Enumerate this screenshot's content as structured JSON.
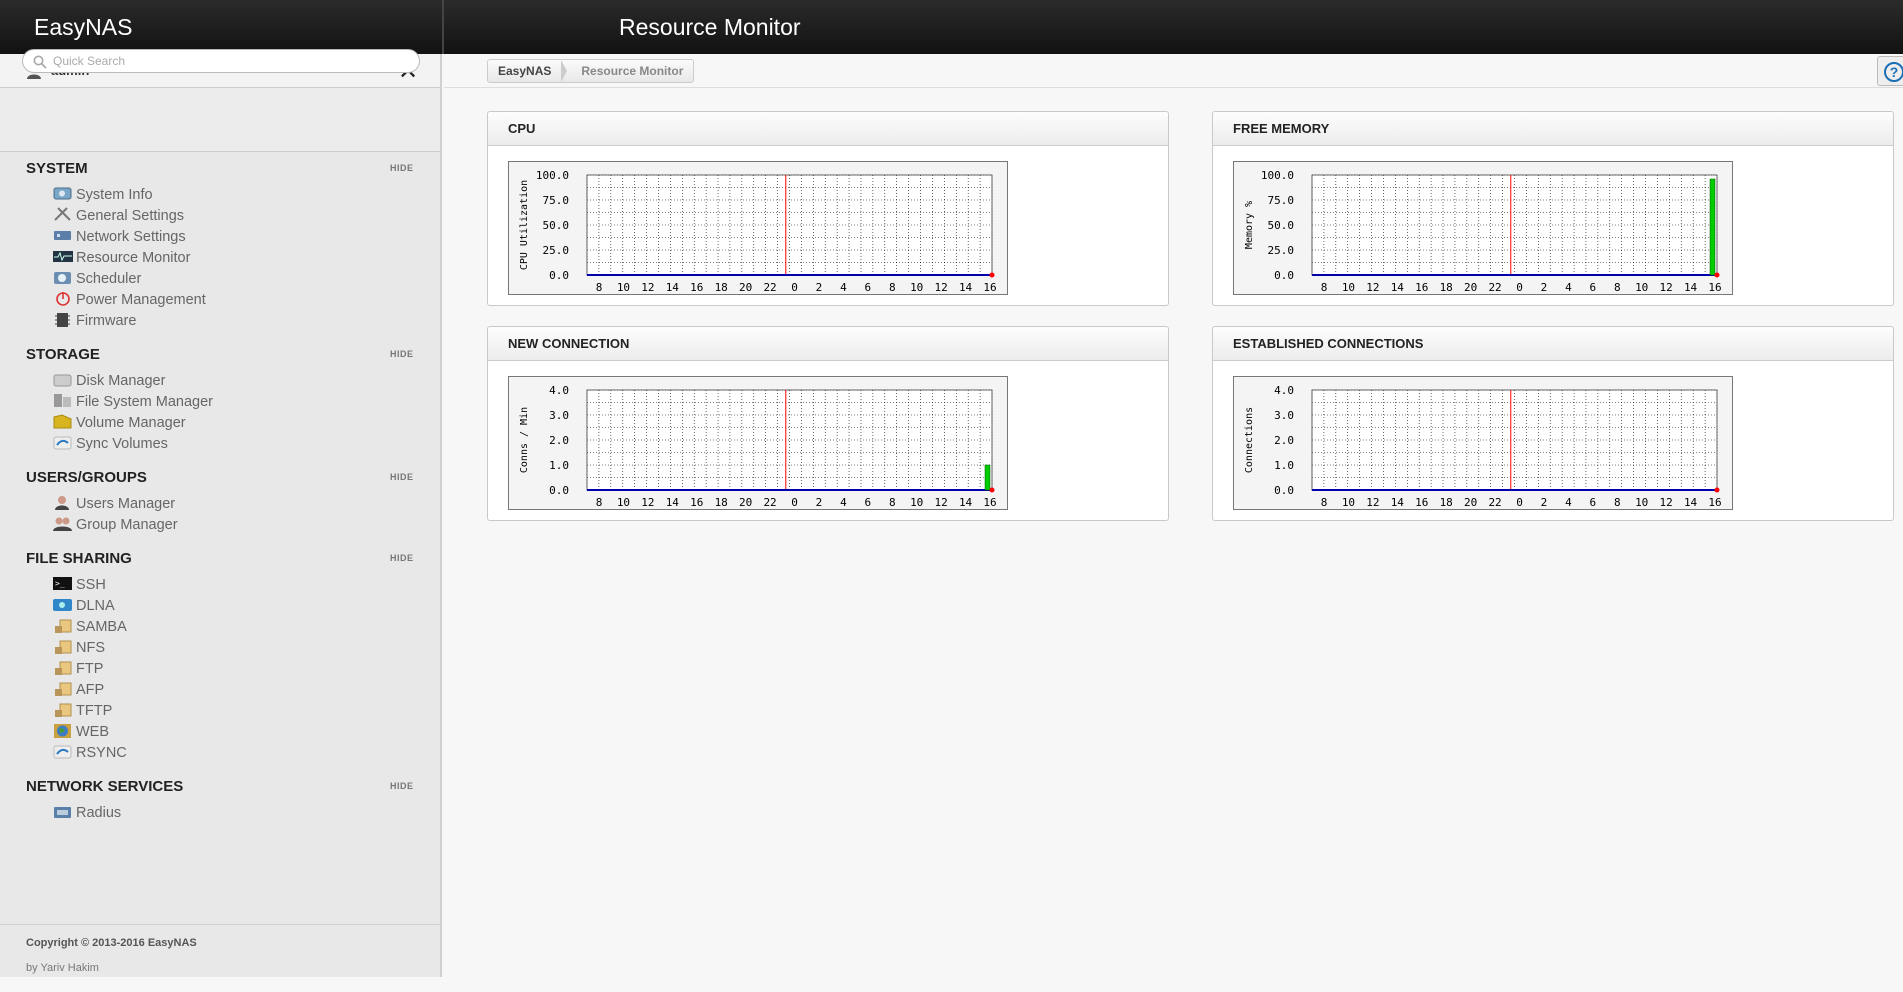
{
  "header": {
    "brand": "EasyNAS",
    "page_title": "Resource Monitor"
  },
  "user": {
    "name": "admin",
    "close_icon": "close-icon"
  },
  "search": {
    "placeholder": "Quick Search"
  },
  "sidebar": {
    "sections": [
      {
        "title": "SYSTEM",
        "hide": "HIDE",
        "items": [
          {
            "label": "System Info",
            "icon": "system-info-icon"
          },
          {
            "label": "General Settings",
            "icon": "general-settings-icon"
          },
          {
            "label": "Network Settings",
            "icon": "network-settings-icon"
          },
          {
            "label": "Resource Monitor",
            "icon": "resource-monitor-icon"
          },
          {
            "label": "Scheduler",
            "icon": "scheduler-icon"
          },
          {
            "label": "Power Management",
            "icon": "power-icon"
          },
          {
            "label": "Firmware",
            "icon": "firmware-icon"
          }
        ]
      },
      {
        "title": "STORAGE",
        "hide": "HIDE",
        "items": [
          {
            "label": "Disk Manager",
            "icon": "disk-icon"
          },
          {
            "label": "File System Manager",
            "icon": "filesystem-icon"
          },
          {
            "label": "Volume Manager",
            "icon": "volume-icon"
          },
          {
            "label": "Sync Volumes",
            "icon": "sync-icon"
          }
        ]
      },
      {
        "title": "USERS/GROUPS",
        "hide": "HIDE",
        "items": [
          {
            "label": "Users Manager",
            "icon": "user-icon"
          },
          {
            "label": "Group Manager",
            "icon": "group-icon"
          }
        ]
      },
      {
        "title": "FILE SHARING",
        "hide": "HIDE",
        "items": [
          {
            "label": "SSH",
            "icon": "terminal-icon"
          },
          {
            "label": "DLNA",
            "icon": "dlna-icon"
          },
          {
            "label": "SAMBA",
            "icon": "share-folder-icon"
          },
          {
            "label": "NFS",
            "icon": "share-folder-icon"
          },
          {
            "label": "FTP",
            "icon": "share-folder-icon"
          },
          {
            "label": "AFP",
            "icon": "share-folder-icon"
          },
          {
            "label": "TFTP",
            "icon": "share-folder-icon"
          },
          {
            "label": "WEB",
            "icon": "globe-icon"
          },
          {
            "label": "RSYNC",
            "icon": "sync-icon"
          }
        ]
      },
      {
        "title": "NETWORK SERVICES",
        "hide": "HIDE",
        "items": [
          {
            "label": "Radius",
            "icon": "radius-icon"
          }
        ]
      }
    ]
  },
  "footer": {
    "copyright": "Copyright © 2013-2016 EasyNAS",
    "byline": "by Yariv Hakim"
  },
  "breadcrumb": [
    "EasyNAS",
    "Resource Monitor"
  ],
  "help_icon": "help-icon",
  "colors": {
    "accent": "#1a6fb5",
    "grid_line": "#000000",
    "now_line": "#ff0000",
    "series": "#00cc00",
    "baseline": "#0000aa"
  },
  "chart_data": [
    {
      "title": "CPU",
      "type": "bar",
      "ylabel": "CPU Utilization",
      "yticks": [
        "100.0",
        "75.0",
        "50.0",
        "25.0",
        "0.0"
      ],
      "ylim": [
        0,
        100
      ],
      "xticks": [
        "8",
        "10",
        "12",
        "14",
        "16",
        "18",
        "20",
        "22",
        "0",
        "2",
        "4",
        "6",
        "8",
        "10",
        "12",
        "14",
        "16"
      ],
      "series": [
        {
          "values_recent": [
            0
          ]
        }
      ]
    },
    {
      "title": "FREE MEMORY",
      "type": "bar",
      "ylabel": "Memory %",
      "yticks": [
        "100.0",
        "75.0",
        "50.0",
        "25.0",
        "0.0"
      ],
      "ylim": [
        0,
        100
      ],
      "xticks": [
        "8",
        "10",
        "12",
        "14",
        "16",
        "18",
        "20",
        "22",
        "0",
        "2",
        "4",
        "6",
        "8",
        "10",
        "12",
        "14",
        "16"
      ],
      "series": [
        {
          "values_recent": [
            96
          ]
        }
      ]
    },
    {
      "title": "NEW CONNECTION",
      "type": "bar",
      "ylabel": "Conns / Min",
      "yticks": [
        "4.0",
        "3.0",
        "2.0",
        "1.0",
        "0.0"
      ],
      "ylim": [
        0,
        4
      ],
      "xticks": [
        "8",
        "10",
        "12",
        "14",
        "16",
        "18",
        "20",
        "22",
        "0",
        "2",
        "4",
        "6",
        "8",
        "10",
        "12",
        "14",
        "16"
      ],
      "series": [
        {
          "values_recent": [
            1
          ]
        }
      ]
    },
    {
      "title": "ESTABLISHED CONNECTIONS",
      "type": "bar",
      "ylabel": "Connections",
      "yticks": [
        "4.0",
        "3.0",
        "2.0",
        "1.0",
        "0.0"
      ],
      "ylim": [
        0,
        4
      ],
      "xticks": [
        "8",
        "10",
        "12",
        "14",
        "16",
        "18",
        "20",
        "22",
        "0",
        "2",
        "4",
        "6",
        "8",
        "10",
        "12",
        "14",
        "16"
      ],
      "series": [
        {
          "values_recent": [
            0
          ]
        }
      ]
    }
  ]
}
